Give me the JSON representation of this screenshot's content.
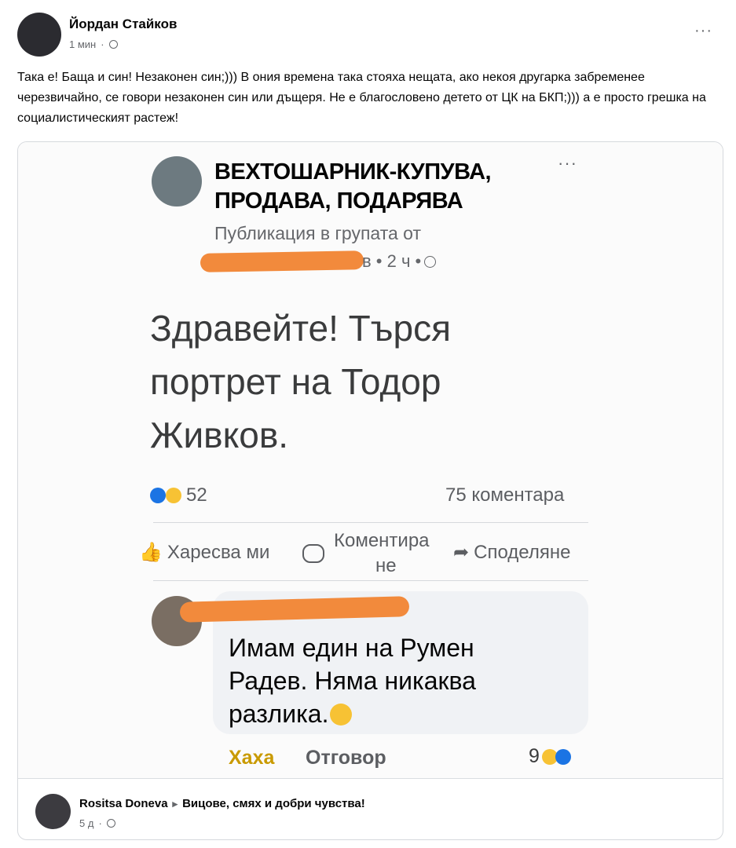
{
  "post": {
    "author": "Йордан Стайков",
    "time": "1 мин",
    "dot": "·",
    "more": "···",
    "text": "Така е! Баща и син! Незаконен син;))) В ония времена така стояха нещата, ако некоя другарка забременее черезвичайно,  се говори незаконен син или дъщеря. Не е благословено детето от ЦК на БКП;))) а е просто грешка на социалистическият растеж!"
  },
  "shot": {
    "group_line1": "ВЕХТОШАРНИК-КУПУВА,",
    "group_line2": "ПРОДАВА, ПОДАРЯВА",
    "more": "···",
    "published_in": "Публикация в групата от",
    "meta_tail": "в • 2 ч •",
    "body_line1": "Здравейте! Търся",
    "body_line2": "портрет на Тодор",
    "body_line3": "Живков.",
    "reactions_count": "52",
    "comments_count": "75 коментара",
    "action_like": "Харесва ми",
    "action_comment_1": "Коментира",
    "action_comment_2": "не",
    "action_share": "Споделяне",
    "comment_line1": "Имам един на Румен",
    "comment_line2": "Радев. Няма никаква",
    "comment_line3": "разлика.",
    "comment_haha": "Хаха",
    "comment_reply": "Отговор",
    "comment_react_count": "9"
  },
  "footer": {
    "author": "Rositsa Doneva",
    "arrow": "▸",
    "group": "Вицове, смях и добри чувства!",
    "time": "5 д",
    "dot": "·"
  },
  "colors": {
    "redaction": "#f28a3c",
    "like_blue": "#1b74e4",
    "haha_yellow": "#f7c234",
    "haha_text": "#c99a00"
  }
}
